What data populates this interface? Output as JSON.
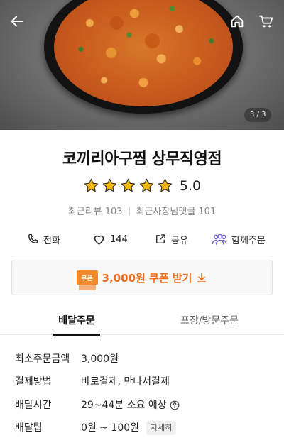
{
  "hero": {
    "image_counter": "3 / 3"
  },
  "store": {
    "name": "코끼리아구찜 상무직영점",
    "rating": "5.0",
    "stars": 5,
    "recent_reviews": "최근리뷰 103",
    "owner_replies": "최근사장님댓글 101"
  },
  "actions": {
    "call": "전화",
    "likes": "144",
    "share": "공유",
    "together": "함께주문"
  },
  "coupon": {
    "badge": "쿠폰",
    "text": "3,000원 쿠폰 받기"
  },
  "tabs": {
    "delivery": "배달주문",
    "pickup": "포장/방문주문"
  },
  "info": {
    "min_order": {
      "label": "최소주문금액",
      "value": "3,000원"
    },
    "payment": {
      "label": "결제방법",
      "value": "바로결제, 만나서결제"
    },
    "delivery_time": {
      "label": "배달시간",
      "value": "29~44분 소요 예상"
    },
    "delivery_tip": {
      "label": "배달팁",
      "value": "0원 ~ 100원",
      "detail": "자세히"
    }
  },
  "icons": {
    "back": "back-arrow-icon",
    "home": "home-icon",
    "cart": "cart-icon",
    "star": "star-icon",
    "phone": "phone-icon",
    "heart": "heart-icon",
    "share": "share-icon",
    "people": "people-icon",
    "download": "download-arrow-icon",
    "help": "question-circle-icon"
  },
  "colors": {
    "accent": "#ee6d1a",
    "star": "#f5b800",
    "together_icon": "#6b5bd6"
  }
}
